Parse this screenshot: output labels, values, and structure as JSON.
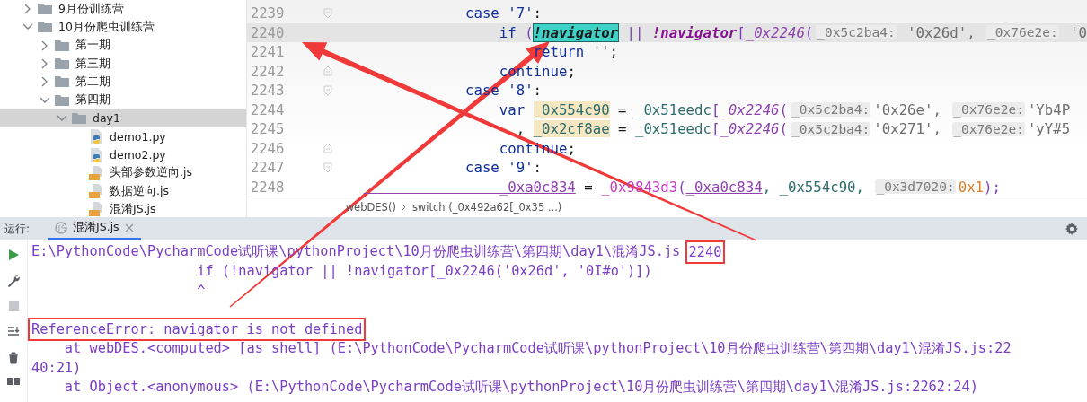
{
  "project_tree": [
    {
      "label": "9月份训练营",
      "kind": "folder",
      "expanded": false,
      "selected": false
    },
    {
      "label": "10月份爬虫训练营",
      "kind": "folder",
      "expanded": true,
      "selected": false,
      "children": [
        {
          "label": "第一期",
          "kind": "folder",
          "expanded": false,
          "selected": false
        },
        {
          "label": "第三期",
          "kind": "folder",
          "expanded": false,
          "selected": false
        },
        {
          "label": "第二期",
          "kind": "folder",
          "expanded": false,
          "selected": false
        },
        {
          "label": "第四期",
          "kind": "folder",
          "expanded": true,
          "selected": false,
          "children": [
            {
              "label": "day1",
              "kind": "folder",
              "expanded": true,
              "selected": true,
              "children": [
                {
                  "label": "demo1.py",
                  "kind": "python",
                  "selected": false
                },
                {
                  "label": "demo2.py",
                  "kind": "python",
                  "selected": false
                },
                {
                  "label": "头部参数逆向.js",
                  "kind": "javascript",
                  "selected": false
                },
                {
                  "label": "数据逆向.js",
                  "kind": "javascript",
                  "selected": false
                },
                {
                  "label": "混淆JS.js",
                  "kind": "javascript",
                  "selected": false
                }
              ]
            }
          ]
        }
      ]
    }
  ],
  "editor": {
    "lines": [
      {
        "number": "2239",
        "current": false,
        "fold_start": true,
        "fold_end": false,
        "tokens": [
          {
            "text": "            case ",
            "kind": "keyword"
          },
          {
            "text": "'7'",
            "kind": "keyword"
          },
          {
            "text": ":",
            "kind": "plain"
          }
        ]
      },
      {
        "number": "2240",
        "current": true,
        "fold_start": false,
        "fold_end": false,
        "tokens": [
          {
            "text": "                if ",
            "kind": "keyword"
          },
          {
            "text": "(",
            "kind": "punct"
          },
          {
            "text": "!navigator",
            "kind": "match"
          },
          {
            "text": " || ",
            "kind": "punct"
          },
          {
            "text": "!navigator",
            "kind": "global"
          },
          {
            "text": "[",
            "kind": "punct"
          },
          {
            "text": "_0x2246",
            "kind": "func"
          },
          {
            "text": "(",
            "kind": "punct"
          },
          {
            "text": "_0x5c2ba4:",
            "kind": "hint"
          },
          {
            "text": " '0x26d', ",
            "kind": "string"
          },
          {
            "text": "_0x76e2e:",
            "kind": "hint"
          },
          {
            "text": " '0",
            "kind": "string"
          }
        ]
      },
      {
        "number": "2241",
        "current": false,
        "fold_start": false,
        "fold_end": false,
        "tokens": [
          {
            "text": "                    return ",
            "kind": "keyword"
          },
          {
            "text": "''",
            "kind": "string"
          },
          {
            "text": ";",
            "kind": "plain"
          }
        ]
      },
      {
        "number": "2242",
        "current": false,
        "fold_start": false,
        "fold_end": true,
        "tokens": [
          {
            "text": "                continue",
            "kind": "keyword"
          },
          {
            "text": ";",
            "kind": "plain"
          }
        ]
      },
      {
        "number": "2243",
        "current": false,
        "fold_start": true,
        "fold_end": false,
        "tokens": [
          {
            "text": "            case ",
            "kind": "keyword"
          },
          {
            "text": "'8'",
            "kind": "keyword"
          },
          {
            "text": ":",
            "kind": "plain"
          }
        ]
      },
      {
        "number": "2244",
        "current": false,
        "fold_start": false,
        "fold_end": false,
        "tokens": [
          {
            "text": "                var ",
            "kind": "keyword"
          },
          {
            "text": "_0x554c90",
            "kind": "declared"
          },
          {
            "text": " = ",
            "kind": "plain"
          },
          {
            "text": "_0x51eedc",
            "kind": "local"
          },
          {
            "text": "[",
            "kind": "punct"
          },
          {
            "text": "_0x2246",
            "kind": "func"
          },
          {
            "text": "(",
            "kind": "punct"
          },
          {
            "text": "_0x5c2ba4:",
            "kind": "hint"
          },
          {
            "text": "'0x26e', ",
            "kind": "string"
          },
          {
            "text": "_0x76e2e:",
            "kind": "hint"
          },
          {
            "text": "'Yb4P",
            "kind": "string"
          }
        ]
      },
      {
        "number": "2245",
        "current": false,
        "fold_start": false,
        "fold_end": false,
        "tokens": [
          {
            "text": "                  , ",
            "kind": "plain"
          },
          {
            "text": "_0x2cf8ae",
            "kind": "declared"
          },
          {
            "text": " = ",
            "kind": "plain"
          },
          {
            "text": "_0x51eedc",
            "kind": "local"
          },
          {
            "text": "[",
            "kind": "punct"
          },
          {
            "text": "_0x2246",
            "kind": "func"
          },
          {
            "text": "(",
            "kind": "punct"
          },
          {
            "text": "_0x5c2ba4:",
            "kind": "hint"
          },
          {
            "text": "'0x271', ",
            "kind": "string"
          },
          {
            "text": "_0x76e2e:",
            "kind": "hint"
          },
          {
            "text": "'yY#5",
            "kind": "string"
          }
        ]
      },
      {
        "number": "2246",
        "current": false,
        "fold_start": false,
        "fold_end": true,
        "tokens": [
          {
            "text": "                continue",
            "kind": "keyword"
          },
          {
            "text": ";",
            "kind": "plain"
          }
        ]
      },
      {
        "number": "2247",
        "current": false,
        "fold_start": true,
        "fold_end": false,
        "tokens": [
          {
            "text": "            case ",
            "kind": "keyword"
          },
          {
            "text": "'9'",
            "kind": "keyword"
          },
          {
            "text": ":",
            "kind": "plain"
          }
        ]
      },
      {
        "number": "2248",
        "current": false,
        "fold_start": false,
        "fold_end": false,
        "tokens": [
          {
            "text": "                _0xa0c834",
            "kind": "reassigned"
          },
          {
            "text": " = ",
            "kind": "plain"
          },
          {
            "text": "_0x9843d3",
            "kind": "callee"
          },
          {
            "text": "(",
            "kind": "punct"
          },
          {
            "text": "_0xa0c834",
            "kind": "reassigned"
          },
          {
            "text": ", _0x554c90, ",
            "kind": "local"
          },
          {
            "text": "_0x3d7020:",
            "kind": "hint"
          },
          {
            "text": "0x1",
            "kind": "number"
          },
          {
            "text": ");",
            "kind": "punct"
          }
        ]
      }
    ],
    "breadcrumb": [
      "webDES()",
      "switch (_0x492a62[_0x35 ...)"
    ]
  },
  "run_panel": {
    "label": "运行:",
    "tabs": [
      {
        "label": "混淆JS.js",
        "selected": true
      }
    ],
    "console_lines": [
      {
        "kind": "text",
        "segments": [
          {
            "text": "E:\\PythonCode\\PycharmCode试听课\\pythonProject\\10月份爬虫训练营\\第四期\\day1\\混淆JS.js ",
            "boxed": false
          },
          {
            "text": "2240",
            "boxed": true
          }
        ]
      },
      {
        "kind": "text",
        "segments": [
          {
            "text": "                    if (!navigator || !navigator[_0x2246('0x26d', '0I#o')])",
            "boxed": false
          }
        ]
      },
      {
        "kind": "text",
        "segments": [
          {
            "text": "                    ^",
            "boxed": false
          }
        ]
      },
      {
        "kind": "blank"
      },
      {
        "kind": "text",
        "segments": [
          {
            "text": "ReferenceError: navigator is not defined",
            "boxed": true
          }
        ]
      },
      {
        "kind": "text",
        "segments": [
          {
            "text": "    at webDES.<computed> [as shell] (E:\\PythonCode\\PycharmCode试听课\\pythonProject\\10月份爬虫训练营\\第四期\\day1\\混淆JS.js:22",
            "boxed": false
          }
        ]
      },
      {
        "kind": "text",
        "segments": [
          {
            "text": "40:21)",
            "boxed": false
          }
        ]
      },
      {
        "kind": "text",
        "segments": [
          {
            "text": "    at Object.<anonymous> (E:\\PythonCode\\PycharmCode试听课\\pythonProject\\10月份爬虫训练营\\第四期\\day1\\混淆JS.js:2262:24)",
            "boxed": false
          }
        ]
      }
    ]
  }
}
